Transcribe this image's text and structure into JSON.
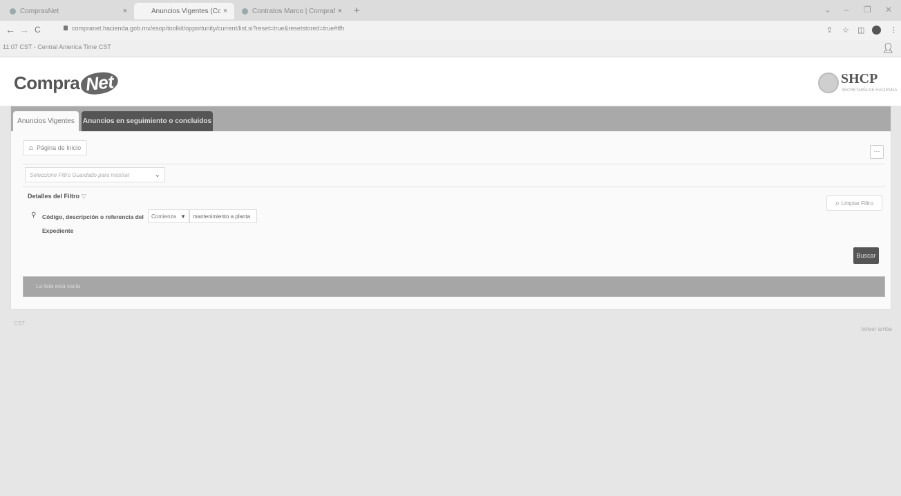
{
  "browser": {
    "tabs": [
      {
        "title": "ComprasNet",
        "close": "×"
      },
      {
        "title": "Anuncios Vigentes (CompraNet)",
        "close": "×"
      },
      {
        "title": "Contratos Marco | CompraNet",
        "close": "×"
      }
    ],
    "new_tab": "+",
    "window_controls": {
      "dropdown": "⌄",
      "minimize": "–",
      "restore": "❐",
      "close": "✕"
    },
    "nav": {
      "back": "←",
      "forward": "→",
      "reload": "C"
    },
    "url": "compranet.hacienda.gob.mx/esop/toolkit/opportunity/current/list.si?reset=true&resetstored=true#tfh",
    "ext_icons": {
      "share": "⇪",
      "star": "☆",
      "sidepanel": "◫",
      "menu": "⋮"
    }
  },
  "infobar": {
    "timezone": "11:07 CST - Central America Time CST",
    "user_icon": "user-icon"
  },
  "header": {
    "logo_part1": "Compra",
    "logo_part2": "Net",
    "shcp_title": "SHCP",
    "shcp_subtitle": "SECRETARÍA DE HACIENDA"
  },
  "main": {
    "tabs": [
      {
        "label": "Anuncios Vigentes"
      },
      {
        "label": "Anuncios en seguimiento o concluidos"
      }
    ],
    "home_button": "Página de Inicio",
    "more_button": "···",
    "filter_select_placeholder": "Seleccione Filtro Guardado para mostrar",
    "filter_details_title": "Detalles del Filtro",
    "filter_details_caret": "▽",
    "clear_filter_button": "Limpiar Filtro",
    "filter_field_label": "Código, descripción o referencia del Expediente",
    "filter_condition": "Comienza",
    "filter_value": "mantenimiento a planta",
    "search_button": "Buscar",
    "empty_message": "La lista está vacía"
  },
  "footer": {
    "right_text": "Volver arriba",
    "left_text": "CST"
  }
}
